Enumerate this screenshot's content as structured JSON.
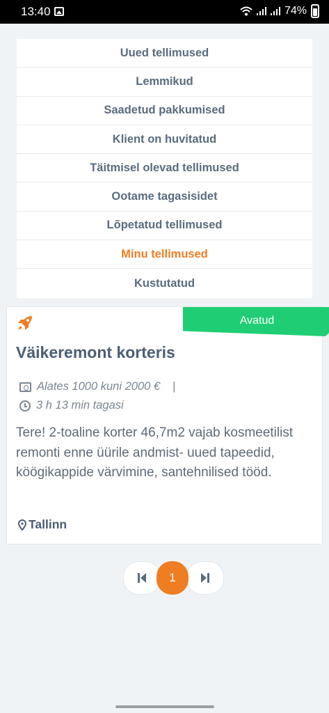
{
  "status_bar": {
    "time": "13:40",
    "battery": "74%",
    "icons": [
      "gallery-icon",
      "wifi-icon",
      "signal-icon",
      "battery-icon"
    ]
  },
  "menu": {
    "items": [
      {
        "label": "Uued tellimused",
        "active": false
      },
      {
        "label": "Lemmikud",
        "active": false
      },
      {
        "label": "Saadetud pakkumised",
        "active": false
      },
      {
        "label": "Klient on huvitatud",
        "active": false
      },
      {
        "label": "Täitmisel olevad tellimused",
        "active": false
      },
      {
        "label": "Ootame tagasisidet",
        "active": false
      },
      {
        "label": "Lõpetatud tellimused",
        "active": false
      },
      {
        "label": "Minu tellimused",
        "active": true
      },
      {
        "label": "Kustutatud",
        "active": false
      }
    ]
  },
  "order_card": {
    "icon": "rocket-icon",
    "status": "Avatud",
    "title": "Väikeremont korteris",
    "price": "Alates 1000 kuni 2000 €",
    "separator": "|",
    "posted": "3 h 13 min tagasi",
    "description": "Tere! 2-toaline korter 46,7m2 vajab kosmeetilist remonti enne üürile andmist- uued tapeedid, köögikappide värvimine, santehnilised tööd.",
    "location": "Tallinn"
  },
  "pagination": {
    "current_page": "1",
    "icons": [
      "first-page-icon",
      "last-page-icon"
    ]
  },
  "colors": {
    "accent": "#ef7d22",
    "status_open": "#1fce74",
    "menu_text": "#5a6b80",
    "title_text": "#4b5e78",
    "background": "#f0f3f6"
  }
}
